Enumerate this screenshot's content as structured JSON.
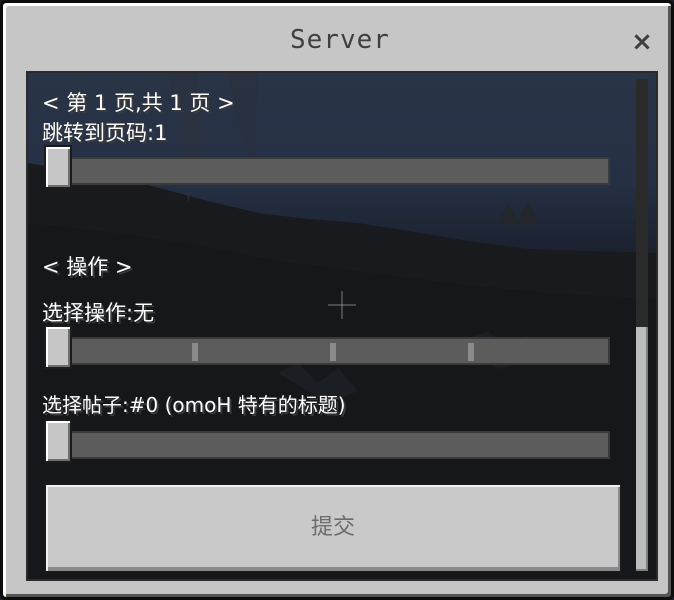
{
  "dialog": {
    "title": "Server",
    "close_glyph": "×"
  },
  "pagination": {
    "prev_glyph": "<",
    "next_glyph": ">",
    "page_label": "第 1 页,共 1 页",
    "jump_label": "跳转到页码:1",
    "slider_value": 0
  },
  "operation": {
    "prev_glyph": "<",
    "next_glyph": ">",
    "header_label": "操作",
    "select_label": "选择操作:无",
    "slider_value": 0,
    "slider_steps": 4
  },
  "post": {
    "select_label": "选择帖子:#0 (omoH 特有的标题)",
    "slider_value": 0
  },
  "submit": {
    "label": "提交"
  },
  "scrollbar": {
    "position": 1.0
  },
  "icons": {
    "close": "close-icon",
    "prev": "chevron-left-icon",
    "next": "chevron-right-icon",
    "crosshair": "crosshair-icon"
  },
  "colors": {
    "dialog_bg": "#c6c6c6",
    "panel_bg": "#1a1e26",
    "text": "#ffffff",
    "title_text": "#3f3f3f",
    "track": "#5c5c5c"
  }
}
